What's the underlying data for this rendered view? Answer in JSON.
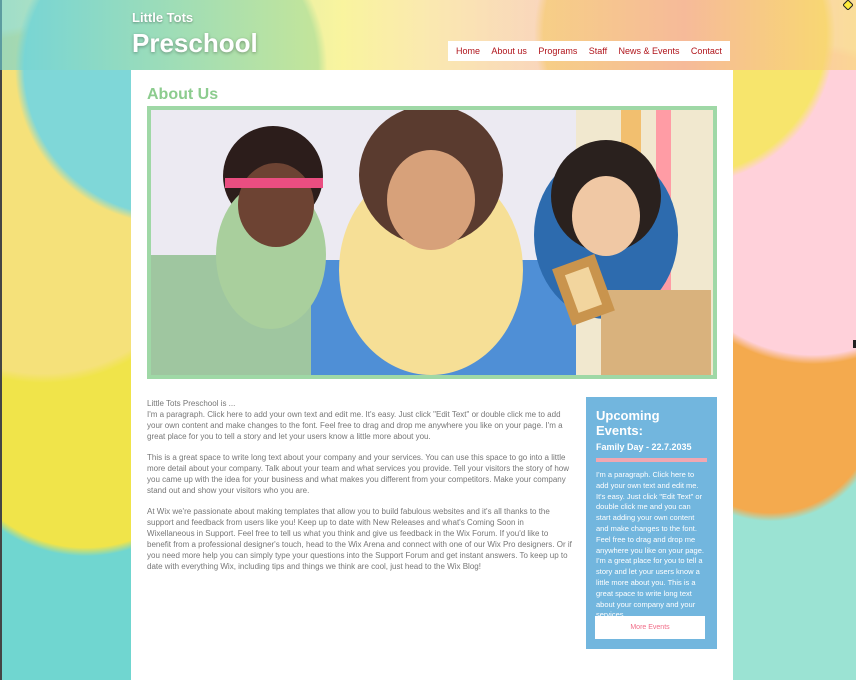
{
  "header": {
    "brand_small": "Little Tots",
    "brand_large": "Preschool"
  },
  "nav": {
    "items": [
      "Home",
      "About us",
      "Programs",
      "Staff",
      "News & Events",
      "Contact"
    ]
  },
  "main": {
    "title": "About Us",
    "paragraphs": [
      "Little Tots Preschool is ...\nI'm a paragraph. Click here to add your own text and edit me. It's easy. Just click \"Edit Text\" or double click me to add your own content and make changes to the font. Feel free to drag and drop me anywhere you like on your page. I'm a great place for you to tell a story and let your users know a little more about you.",
      "This is a great space to write long text about your company and your services. You can use this space to go into a little more detail about your company. Talk about your team and what services you provide. Tell your visitors the story of how you came up with the idea for your business and what makes you different from your competitors. Make your company stand out and show your visitors who you are.",
      "At Wix we're passionate about making templates that allow you to build fabulous websites and it's all thanks to the support and feedback from users like you! Keep up to date with New Releases and what's Coming Soon in Wixellaneous in Support. Feel free to tell us what you think and give us feedback in the Wix Forum. If you'd like to benefit from a professional designer's touch, head to the Wix Arena and connect with one of our Wix Pro designers. Or if you need more help you can simply type your questions into the Support Forum and get instant answers. To keep up to date with everything Wix, including tips and things we think are cool, just head to the Wix Blog!"
    ]
  },
  "sidebar": {
    "title": "Upcoming Events:",
    "date": "Family Day - 22.7.2035",
    "copy": "I'm a paragraph. Click here to add your own text and edit me. It's easy. Just click \"Edit Text\" or double click me and you can start adding your own content and make changes to the font. Feel free to drag and drop me anywhere you like on your page. I'm a great place for you to tell a story and let your users know a little more about you. This is a great space to write long text about your company and your services.",
    "button": "More Events"
  },
  "colors": {
    "nav_text": "#b0141b",
    "title_green": "#8ccc8e",
    "sidebar_blue": "#72b6de",
    "button_text": "#f16d88"
  }
}
